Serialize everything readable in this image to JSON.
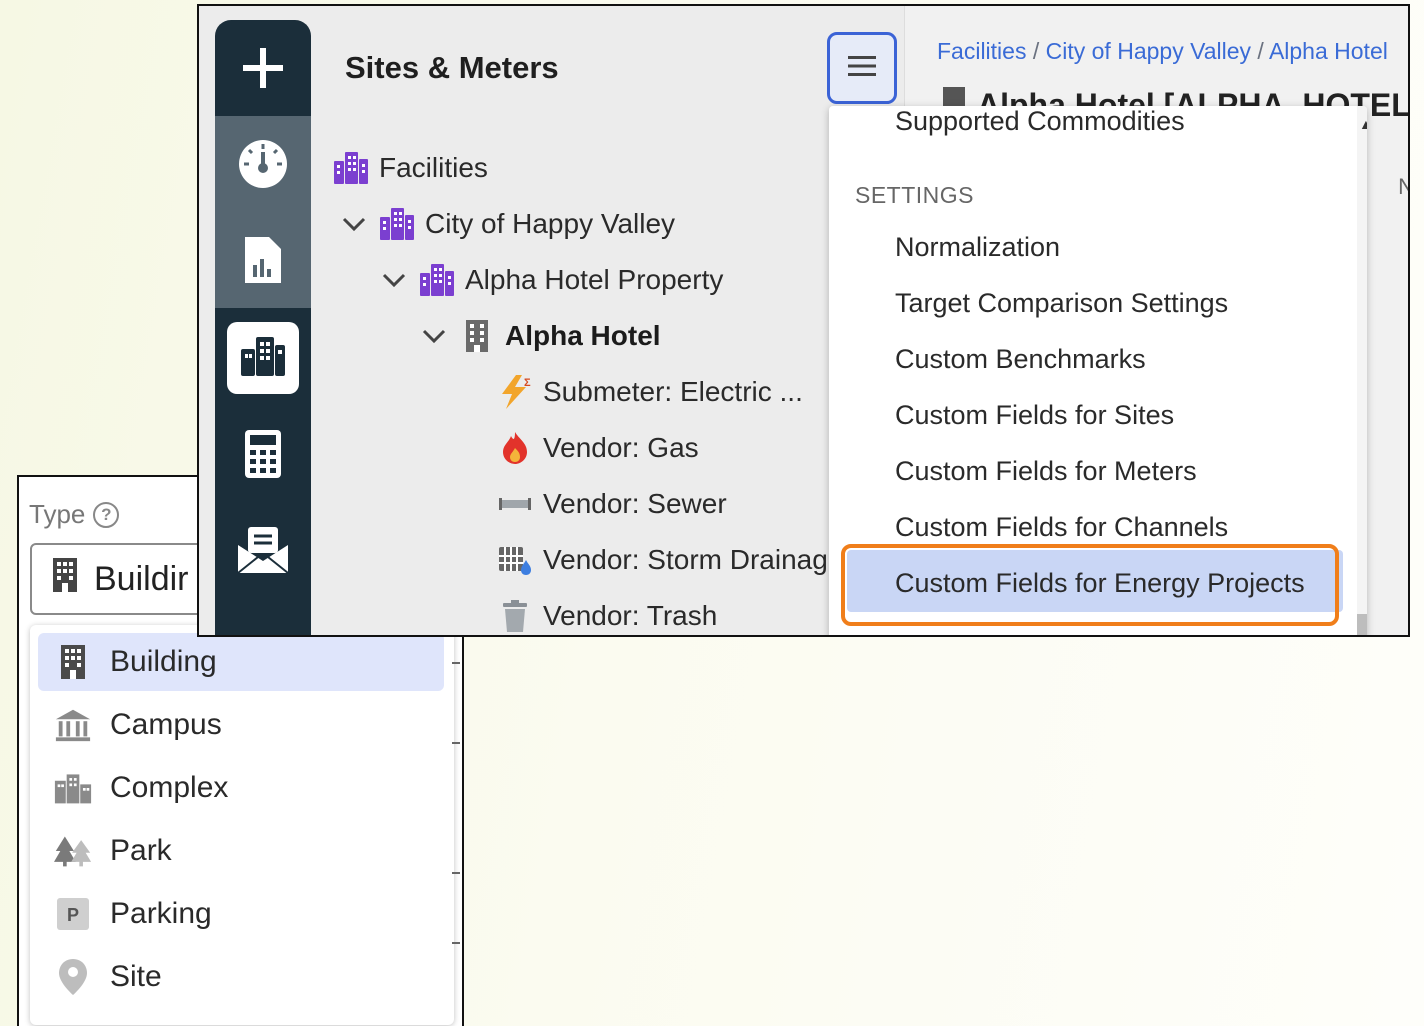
{
  "type_panel": {
    "label": "Type",
    "selected_value": "Buildir",
    "options": [
      {
        "label": "Building",
        "icon": "building-icon",
        "selected": true
      },
      {
        "label": "Campus",
        "icon": "campus-icon",
        "selected": false
      },
      {
        "label": "Complex",
        "icon": "complex-icon",
        "selected": false
      },
      {
        "label": "Park",
        "icon": "park-icon",
        "selected": false
      },
      {
        "label": "Parking",
        "icon": "parking-icon",
        "selected": false
      },
      {
        "label": "Site",
        "icon": "site-pin-icon",
        "selected": false
      }
    ]
  },
  "rail": {
    "items": [
      "add-icon",
      "dashboard-gauge-icon",
      "reports-icon",
      "facilities-icon",
      "calculator-icon",
      "mail-icon"
    ]
  },
  "sites_panel": {
    "title": "Sites & Meters",
    "tree": [
      {
        "label": "Facilities",
        "icon": "facilities-icon",
        "level": 0,
        "expanded": null
      },
      {
        "label": "City of Happy Valley",
        "icon": "facilities-icon",
        "level": 1,
        "expanded": true
      },
      {
        "label": "Alpha Hotel Property",
        "icon": "facilities-icon",
        "level": 2,
        "expanded": true
      },
      {
        "label": "Alpha Hotel",
        "icon": "building-icon",
        "level": 3,
        "expanded": true,
        "bold": true
      },
      {
        "label": "Submeter: Electric ...",
        "icon": "electric-submeter-icon",
        "level": 4
      },
      {
        "label": "Vendor: Gas",
        "icon": "gas-flame-icon",
        "level": 4
      },
      {
        "label": "Vendor: Sewer",
        "icon": "sewer-pipe-icon",
        "level": 4
      },
      {
        "label": "Vendor: Storm Drainage",
        "icon": "storm-drainage-icon",
        "level": 4
      },
      {
        "label": "Vendor: Trash",
        "icon": "trash-icon",
        "level": 4
      }
    ]
  },
  "header": {
    "breadcrumb": [
      "Facilities",
      "City of Happy Valley",
      "Alpha Hotel"
    ],
    "breadcrumb_sep": "/",
    "title": "Alpha Hotel [ALPHA_HOTEL]",
    "edge_text": "N"
  },
  "settings_menu": {
    "top_item": "Supported Commodities",
    "section_header": "SETTINGS",
    "items": [
      "Normalization",
      "Target Comparison Settings",
      "Custom Benchmarks",
      "Custom Fields for Sites",
      "Custom Fields for Meters",
      "Custom Fields for Channels",
      "Custom Fields for Energy Projects"
    ],
    "highlighted_item": "Custom Fields for Energy Projects"
  },
  "colors": {
    "rail_bg": "#1b2e3a",
    "rail_selected": "#566671",
    "facilities_purple": "#7b3fd0",
    "link_blue": "#3a6bd6",
    "highlight_blue": "#c9d6f5",
    "callout_orange": "#f07e1a"
  }
}
